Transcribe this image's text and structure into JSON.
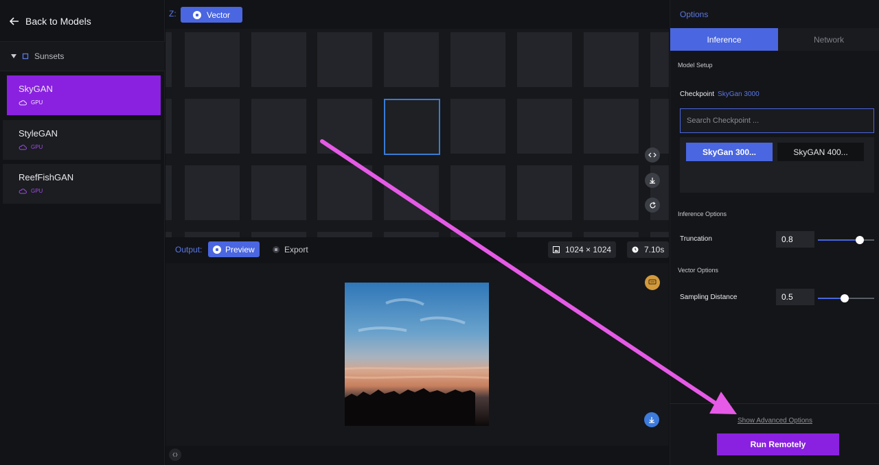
{
  "sidebar": {
    "back_label": "Back to Models",
    "group_label": "Sunsets",
    "models": [
      {
        "name": "SkyGAN",
        "tag": "GPU"
      },
      {
        "name": "StyleGAN",
        "tag": "GPU"
      },
      {
        "name": "ReefFishGAN",
        "tag": "GPU"
      }
    ]
  },
  "latent": {
    "z_label": "Z:",
    "vector_label": "Vector"
  },
  "output": {
    "label": "Output:",
    "preview_label": "Preview",
    "export_label": "Export",
    "resolution": "1024 × 1024",
    "time": "7.10s"
  },
  "options": {
    "title": "Options",
    "tabs": [
      "Inference",
      "Network"
    ],
    "model_setup": "Model Setup",
    "checkpoint_label": "Checkpoint",
    "checkpoint_value": "SkyGan 3000",
    "search_placeholder": "Search Checkpoint ...",
    "checkpoints": [
      "SkyGan 300...",
      "SkyGAN 400..."
    ],
    "inference_options": "Inference Options",
    "truncation_label": "Truncation",
    "truncation_value": "0.8",
    "truncation_fraction": 0.74,
    "vector_options": "Vector Options",
    "sampling_label": "Sampling Distance",
    "sampling_value": "0.5",
    "sampling_fraction": 0.48,
    "show_advanced": "Show Advanced Options",
    "run_label": "Run Remotely"
  },
  "colors": {
    "accent_blue": "#4a66e0",
    "accent_purple": "#8a21e0",
    "annotation_arrow": "#e55ae6"
  },
  "icons": [
    "back-arrow-icon",
    "caret-down-icon",
    "folder-icon",
    "cloud-icon",
    "code-icon",
    "download-icon",
    "refresh-icon",
    "eye-icon",
    "image-icon",
    "clock-icon",
    "chat-icon",
    "expand-icon"
  ]
}
